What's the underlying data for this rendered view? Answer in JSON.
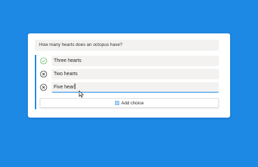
{
  "question": {
    "text": "How many hearts does an octopus have?"
  },
  "choices": [
    {
      "label": "Three hearts",
      "state": "correct"
    },
    {
      "label": "Two hearts",
      "state": "removable"
    },
    {
      "label": "Five hear",
      "state": "editing"
    }
  ],
  "add_choice": {
    "label": "Add choice"
  },
  "colors": {
    "accent": "#1e88e5",
    "correct": "#6bb56b",
    "background": "#1e88e5"
  }
}
